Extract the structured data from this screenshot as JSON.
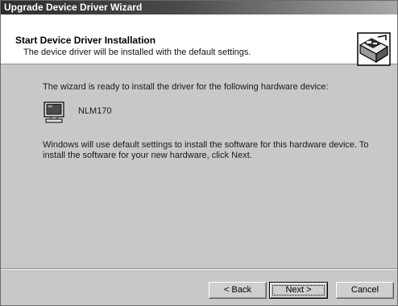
{
  "window": {
    "title": "Upgrade Device Driver Wizard"
  },
  "header": {
    "title": "Start Device Driver Installation",
    "subtitle": "The device driver will be installed with the default settings.",
    "icon": "hardware-wizard-icon"
  },
  "content": {
    "intro": "The wizard is ready to install the driver for the following hardware device:",
    "device_icon": "monitor-icon",
    "device_name": "NLM170",
    "info": "Windows will use default settings to install the software for this hardware device. To install the software for your new hardware, click Next."
  },
  "buttons": {
    "back": "< Back",
    "next": "Next >",
    "cancel": "Cancel"
  }
}
